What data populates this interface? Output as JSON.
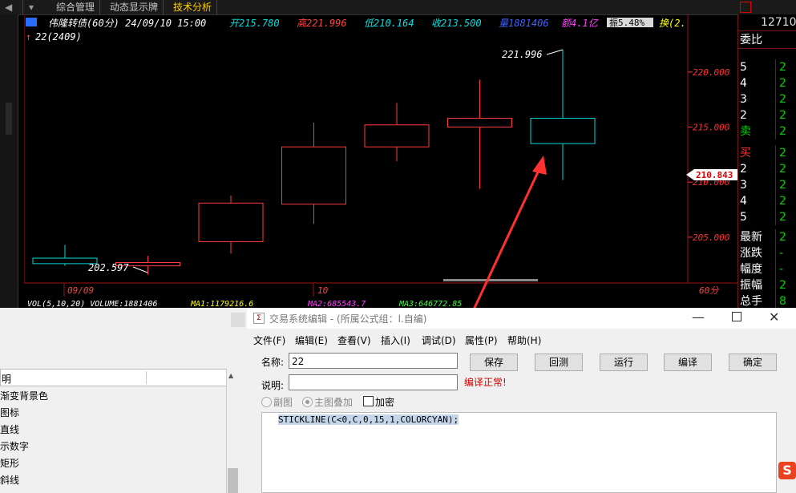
{
  "tabs": [
    {
      "label": "综合管理"
    },
    {
      "label": "动态显示牌"
    },
    {
      "label": "技术分析"
    }
  ],
  "chart": {
    "title": "伟隆转债(60分) 24/09/10 15:00",
    "open": "开215.780",
    "high": "高221.996",
    "low": "低210.164",
    "close": "收213.500",
    "volume_label": "量1881406",
    "amount_label": "额4.1亿",
    "change_label": "振5.48%",
    "change2_label": "换(2.",
    "indicator": "22(2409)",
    "high_marker": "221.996",
    "low_marker": "202.597",
    "current_price": "210.843",
    "date_left": "09/09",
    "date_mid": "10",
    "period": "60分",
    "vol_line": "VOL(5,10,20) VOLUME:1881406",
    "ma1": "MA1:1179216.6",
    "ma2": "MA2:685543.7",
    "ma3": "MA3:646772.85",
    "colors": {
      "up": "#ff3b3b",
      "down": "#00d8d8"
    }
  },
  "chart_data": {
    "type": "candlestick",
    "title": "伟隆转债(60分) 24/09/10 15:00",
    "ylim": [
      201.5,
      224.5
    ],
    "y_ticks": [
      205.0,
      210.0,
      215.0,
      220.0
    ],
    "y_tick_labels": [
      "205.000",
      "210.000",
      "215.000",
      "220.000"
    ],
    "candles": [
      {
        "open": 203.1,
        "high": 204.3,
        "low": 202.4,
        "close": 202.6,
        "dir": "down"
      },
      {
        "open": 202.4,
        "high": 203.3,
        "low": 201.6,
        "close": 202.7,
        "dir": "up"
      },
      {
        "open": 204.6,
        "high": 208.8,
        "low": 203.5,
        "close": 208.1,
        "dir": "up"
      },
      {
        "open": 208.0,
        "high": 215.4,
        "low": 206.2,
        "close": 213.2,
        "dir": "up"
      },
      {
        "open": 213.2,
        "high": 217.2,
        "low": 211.9,
        "close": 215.2,
        "dir": "up"
      },
      {
        "open": 215.0,
        "high": 219.3,
        "low": 209.4,
        "close": 215.8,
        "dir": "up"
      },
      {
        "open": 215.8,
        "high": 222.0,
        "low": 210.2,
        "close": 213.5,
        "dir": "down"
      }
    ]
  },
  "rpanel": {
    "top_value": "12710",
    "header": "委比",
    "sell_rows": [
      {
        "label": "5",
        "value": "2"
      },
      {
        "label": "4",
        "value": "2"
      },
      {
        "label": "3",
        "value": "2"
      },
      {
        "label": "2",
        "value": "2"
      },
      {
        "label": "卖",
        "value": "2"
      }
    ],
    "buy_rows": [
      {
        "label": "买",
        "value": "2"
      },
      {
        "label": "2",
        "value": "2"
      },
      {
        "label": "3",
        "value": "2"
      },
      {
        "label": "4",
        "value": "2"
      },
      {
        "label": "5",
        "value": "2"
      }
    ],
    "stats": [
      {
        "label": "最新",
        "value": "2"
      },
      {
        "label": "涨跌",
        "value": "-"
      },
      {
        "label": "幅度",
        "value": "-"
      },
      {
        "label": "振幅",
        "value": "2"
      },
      {
        "label": "总手",
        "value": "8"
      }
    ]
  },
  "listpanel": {
    "header": "明",
    "items": [
      "渐变背景色",
      "图标",
      "直线",
      "示数字",
      "矩形",
      "斜线"
    ]
  },
  "dialog": {
    "title": "交易系统编辑 - (所属公式组：l.自编)",
    "menus": [
      "文件(F)",
      "编辑(E)",
      "查看(V)",
      "插入(I)",
      "调试(D)",
      "属性(P)",
      "帮助(H)"
    ],
    "name_label": "名称:",
    "name_value": "22",
    "desc_label": "说明:",
    "desc_value": "",
    "status_text": "编译正常!",
    "buttons": {
      "save": "保存",
      "backtest": "回测",
      "run": "运行",
      "compile": "编译",
      "ok": "确定"
    },
    "radio_sub": "副图",
    "radio_main": "主图叠加",
    "checkbox_encrypt": "加密",
    "code": "STICKLINE(C<0,C,0,15,1,COLORCYAN);"
  }
}
